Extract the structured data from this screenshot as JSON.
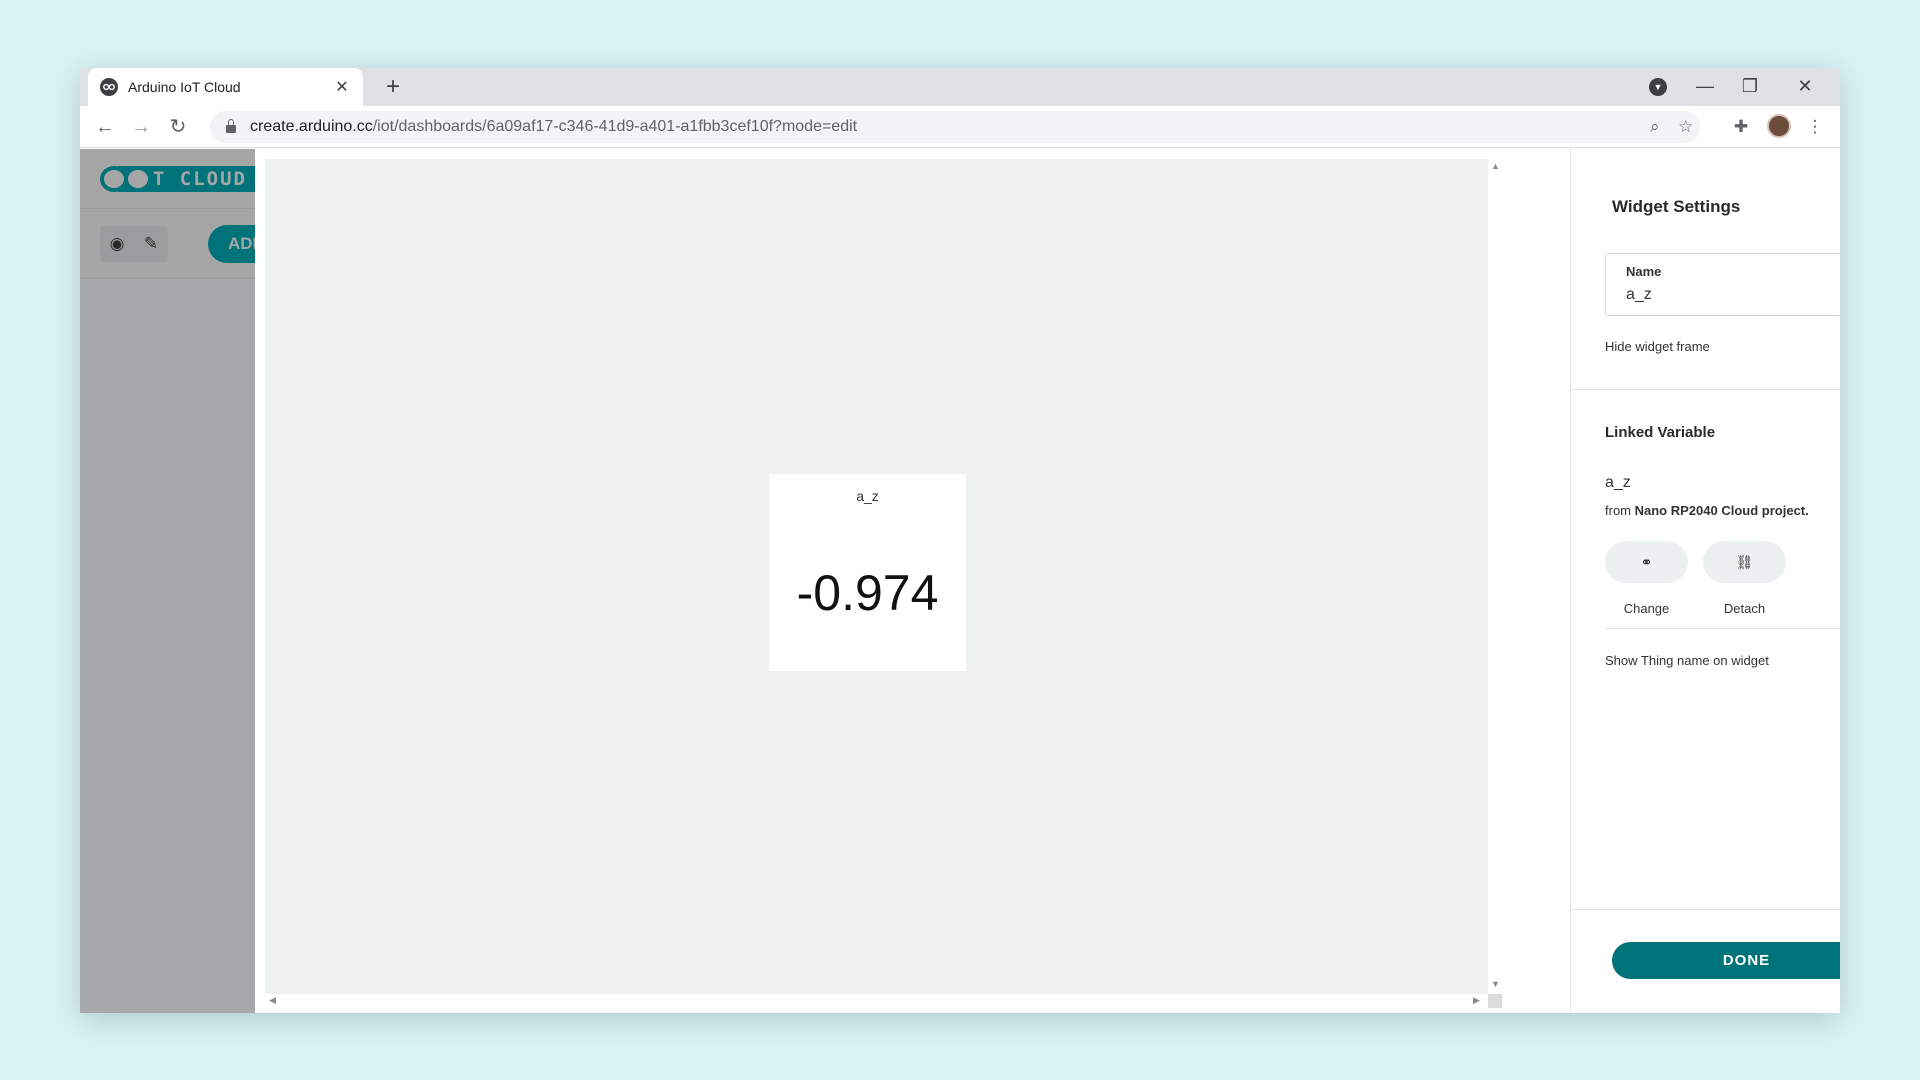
{
  "browser": {
    "tab_title": "Arduino IoT Cloud",
    "url_host": "create.arduino.cc",
    "url_path": "/iot/dashboards/6a09af17-c346-41d9-a401-a1fbb3cef10f?mode=edit"
  },
  "left_nav": {
    "logo_text": "IOT CLOUD",
    "add_button_label": "ADD"
  },
  "widget": {
    "name": "a_z",
    "value": "-0.974"
  },
  "settings": {
    "title": "Widget Settings",
    "name_label": "Name",
    "name_value": "a_z",
    "hide_frame_label": "Hide widget frame",
    "hide_frame_on": false,
    "linked_variable_title": "Linked Variable",
    "variable_name": "a_z",
    "source_prefix": "from",
    "source_name": "Nano RP2040 Cloud project.",
    "change_label": "Change",
    "detach_label": "Detach",
    "show_thing_label": "Show Thing name on widget",
    "show_thing_on": false,
    "done_label": "DONE"
  },
  "colors": {
    "accent": "#00737a",
    "page_bg": "#d9f3f5"
  }
}
